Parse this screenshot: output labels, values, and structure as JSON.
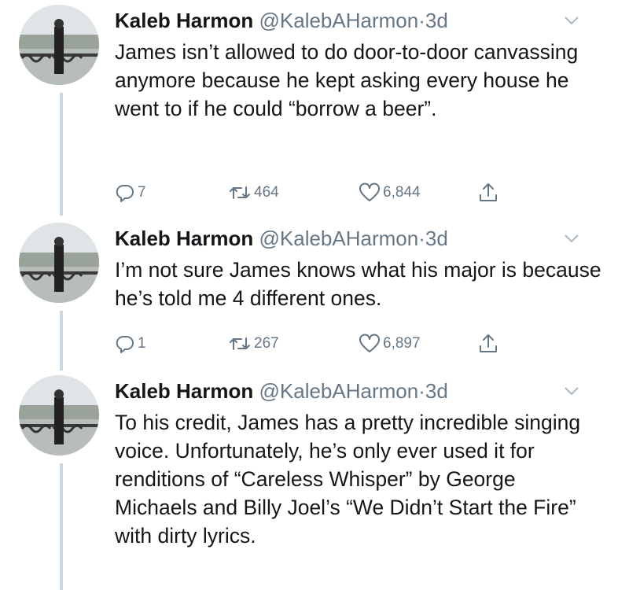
{
  "tweets": [
    {
      "name": "Kaleb Harmon",
      "handle": "@KalebAHarmon",
      "dot": "·",
      "time": "3d",
      "text": "James isn’t allowed to do door-to-door canvassing anymore because he kept asking every house he went to if he could “borrow a beer”.",
      "replies": "7",
      "retweets": "464",
      "likes": "6,844"
    },
    {
      "name": "Kaleb Harmon",
      "handle": "@KalebAHarmon",
      "dot": "·",
      "time": "3d",
      "text": "I’m not sure James knows what his major is because he’s told me 4 different ones.",
      "replies": "1",
      "retweets": "267",
      "likes": "6,897"
    },
    {
      "name": "Kaleb Harmon",
      "handle": "@KalebAHarmon",
      "dot": "·",
      "time": "3d",
      "text": "To his credit, James has a pretty incredible singing voice. Unfortunately, he’s only ever used it for renditions of “Careless Whisper” by George Michaels and Billy Joel’s “We Didn’t Start the Fire” with dirty lyrics."
    }
  ],
  "icons": {
    "reply": "reply-icon",
    "retweet": "retweet-icon",
    "like": "heart-icon",
    "share": "share-icon",
    "menu": "chevron-down-icon"
  },
  "colors": {
    "text": "#14171a",
    "secondary": "#657786",
    "thread_line": "#ccd6dd"
  }
}
